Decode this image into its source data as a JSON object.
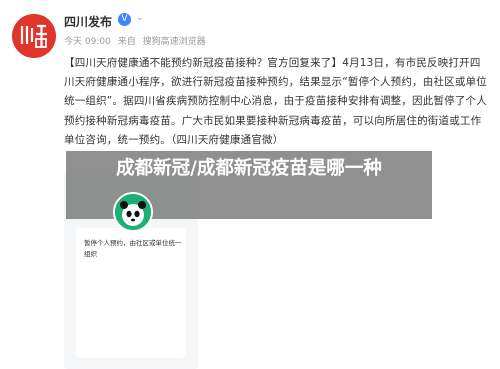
{
  "account": {
    "name": "四川发布",
    "verified_badge": "V",
    "menu_caret": "⌄",
    "time": "今天 09:00",
    "source_prefix": "来自",
    "source": "搜狗高速浏览器",
    "avatar_icon": "sichuan-logo-icon"
  },
  "post": {
    "text": "【四川天府健康通不能预约新冠疫苗接种？官方回复来了】4月13日，有市民反映打开四川天府健康通小程序，欲进行新冠疫苗接种预约，结果显示“暂停个人预约，由社区或单位统一组织”。据四川省疾病预防控制中心消息，由于疫苗接种安排有调整，因此暂停了个人预约接种新冠病毒疫苗。广大市民如果要接种新冠病毒疫苗，可以向所居住的街道或工作单位咨询，统一预约。（四川天府健康通官微）"
  },
  "screenshot": {
    "message": "暂停个人预约，由社区或单位统一组织",
    "panda_icon": "panda-icon"
  },
  "overlay": {
    "title": "成都新冠/成都新冠疫苗是哪一种"
  },
  "colors": {
    "brand_red": "#e0352b",
    "verified_blue": "#3a86ff",
    "panda_green": "#1fae77"
  }
}
